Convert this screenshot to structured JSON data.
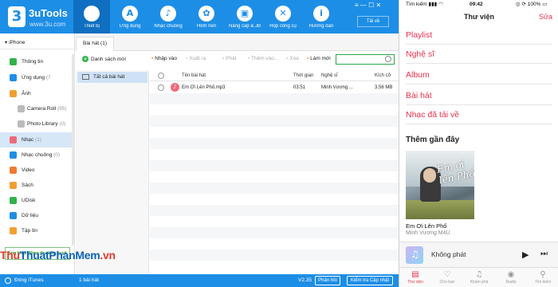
{
  "app": {
    "title": "3uTools",
    "subtitle": "www.3u.com",
    "nav": [
      {
        "label": "Thiết bị",
        "icon": "apple-icon",
        "glyph": ""
      },
      {
        "label": "Ứng dụng",
        "icon": "appstore-icon",
        "glyph": "A"
      },
      {
        "label": "Nhạc chuông",
        "icon": "bell-icon",
        "glyph": "♪"
      },
      {
        "label": "Hình nền",
        "icon": "wallpaper-icon",
        "glyph": "✿"
      },
      {
        "label": "Nâng cấp & JB",
        "icon": "box-icon",
        "glyph": "▣"
      },
      {
        "label": "Hộp công cụ",
        "icon": "tools-icon",
        "glyph": "✕"
      },
      {
        "label": "Hướng dẫn",
        "icon": "info-icon",
        "glyph": "i"
      }
    ],
    "window_controls": "≡  —  ☐  ✕",
    "download_label": "Tải về"
  },
  "sidebar": {
    "device": "iPhone",
    "items": [
      {
        "label": "Thông tin",
        "count": "",
        "color": "#2fb34a",
        "sub": false,
        "active": false
      },
      {
        "label": "Ứng dụng",
        "count": "(7",
        "color": "#1d8ee6",
        "sub": false,
        "active": false
      },
      {
        "label": "Ảnh",
        "count": "",
        "color": "#f0a030",
        "sub": false,
        "active": false
      },
      {
        "label": "Camera Roll",
        "count": "(95)",
        "color": "#bbbbbb",
        "sub": true,
        "active": false
      },
      {
        "label": "Photo Library",
        "count": "(0)",
        "color": "#bbbbbb",
        "sub": true,
        "active": false
      },
      {
        "label": "Nhạc",
        "count": "(1)",
        "color": "#ef6a7a",
        "sub": false,
        "active": true
      },
      {
        "label": "Nhạc chuông",
        "count": "(0)",
        "color": "#1d8ee6",
        "sub": false,
        "active": false
      },
      {
        "label": "Video",
        "count": "",
        "color": "#f07a30",
        "sub": false,
        "active": false
      },
      {
        "label": "Sách",
        "count": "",
        "color": "#f0a030",
        "sub": false,
        "active": false
      },
      {
        "label": "UDisk",
        "count": "",
        "color": "#2fb34a",
        "sub": false,
        "active": false
      },
      {
        "label": "Dữ liệu",
        "count": "",
        "color": "#1d8ee6",
        "sub": false,
        "active": false
      },
      {
        "label": "Tập tin",
        "count": "",
        "color": "#f0a030",
        "sub": false,
        "active": false
      }
    ],
    "status": "ống hoạt động thường xuyê"
  },
  "content": {
    "tab": "Bài hát (1)",
    "new_list": "Danh sách mới",
    "toolbar": [
      {
        "label": "Nhập vào",
        "enabled": true
      },
      {
        "label": "Xuất ra",
        "enabled": false
      },
      {
        "label": "Phát",
        "enabled": false
      },
      {
        "label": "Thêm vào...",
        "enabled": false
      },
      {
        "label": "Xóa",
        "enabled": false
      },
      {
        "label": "Làm mới",
        "enabled": true
      }
    ],
    "playlist_all": "Tất cả bài hát",
    "columns": {
      "name": "Tên bài hát",
      "time": "Thời gian",
      "artist": "Nghệ sĩ",
      "size": "Kích cỡ"
    },
    "songs": [
      {
        "name": "Em Ơi Lên Phố.mp3",
        "time": "03:51",
        "artist": "Minh Vương ...",
        "size": "3.56 MB"
      }
    ]
  },
  "bottombar": {
    "itunes": "Đóng iTunes",
    "count": "1 bài hát",
    "version": "V2.35",
    "feedback": "Phản hồi",
    "update": "Kiểm tra Cập nhật"
  },
  "watermark": {
    "part1": "Thu",
    "part2": "ThuatPhanMem",
    "part3": ".vn"
  },
  "phone": {
    "status_left": "Tìm kiếm  ▮▮▮  ◠",
    "time": "09:42",
    "status_right": "◎ ⟳ 100% ▭",
    "title": "Thư viện",
    "edit": "Sửa",
    "library": [
      "Playlist",
      "Nghệ sĩ",
      "Album",
      "Bài hát",
      "Nhạc đã tải về"
    ],
    "recent_heading": "Thêm gần đây",
    "album_script": "Em ơi lên Phố",
    "album_title": "Em Ơi Lên Phố",
    "album_artist": "Minh Vương M4U",
    "mini_text": "Không phát",
    "tabs": [
      {
        "label": "Thư viện",
        "glyph": "▤",
        "active": true
      },
      {
        "label": "Cho bạn",
        "glyph": "♡",
        "active": false
      },
      {
        "label": "Khám phá",
        "glyph": "♫",
        "active": false
      },
      {
        "label": "Radio",
        "glyph": "◉",
        "active": false
      },
      {
        "label": "Tìm kiếm",
        "glyph": "⚲",
        "active": false
      }
    ]
  },
  "colors": {
    "brand_blue": "#1d8ee6",
    "accent_red": "#e8334d"
  }
}
